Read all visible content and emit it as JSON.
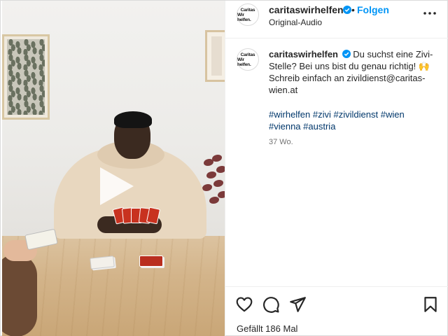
{
  "post": {
    "username": "caritaswirhelfen",
    "avatar_text_line1": "Caritas",
    "avatar_text_line2": "Wir helfen.",
    "separator": "•",
    "follow_label": "Folgen",
    "audio_label": "Original-Audio",
    "more_icon": "more-horizontal-icon",
    "verified_color": "#0095f6",
    "follow_color": "#0095f6",
    "hashtag_color": "#00376b"
  },
  "caption": {
    "username": "caritaswirhelfen",
    "text": " Du suchst eine Zivi-Stelle? Bei uns bist du genau richtig! 🙌 Schreib einfach an zivildienst@caritas-wien.at",
    "hashtags": [
      "#wirhelfen",
      "#zivi",
      "#zivildienst",
      "#wien",
      "#vienna",
      "#austria"
    ],
    "timestamp": "37 Wo."
  },
  "actions": {
    "like_icon": "heart-icon",
    "comment_icon": "comment-icon",
    "share_icon": "send-icon",
    "save_icon": "bookmark-icon",
    "likes_text": "Gefällt 186 Mal"
  },
  "media": {
    "play_icon": "play-icon"
  }
}
